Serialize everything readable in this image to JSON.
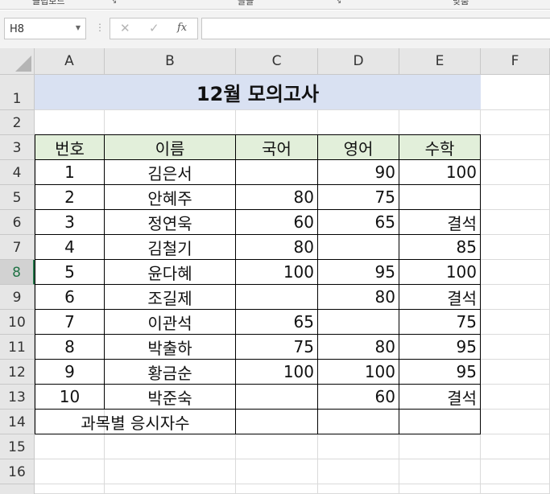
{
  "ribbon": {
    "group_clipboard": "클립보드",
    "group_font": "글꼴",
    "group_alignment": "맞춤",
    "launcher_glyph": "↘"
  },
  "formula_bar": {
    "name_box": "H8",
    "cancel_glyph": "✕",
    "enter_glyph": "✓",
    "fx_glyph": "fx",
    "formula": ""
  },
  "sheet": {
    "columns": [
      "A",
      "B",
      "C",
      "D",
      "E",
      "F"
    ],
    "rows": [
      "1",
      "2",
      "3",
      "4",
      "5",
      "6",
      "7",
      "8",
      "9",
      "10",
      "11",
      "12",
      "13",
      "14",
      "15",
      "16"
    ],
    "selected_row": "8",
    "title": "12월 모의고사",
    "headers": [
      "번호",
      "이름",
      "국어",
      "영어",
      "수학"
    ],
    "data": [
      [
        "1",
        "김은서",
        "",
        "90",
        "100"
      ],
      [
        "2",
        "안혜주",
        "80",
        "75",
        ""
      ],
      [
        "3",
        "정연욱",
        "60",
        "65",
        "결석"
      ],
      [
        "4",
        "김철기",
        "80",
        "",
        "85"
      ],
      [
        "5",
        "윤다혜",
        "100",
        "95",
        "100"
      ],
      [
        "6",
        "조길제",
        "",
        "80",
        "결석"
      ],
      [
        "7",
        "이관석",
        "65",
        "",
        "75"
      ],
      [
        "8",
        "박출하",
        "75",
        "80",
        "95"
      ],
      [
        "9",
        "황금순",
        "100",
        "100",
        "95"
      ],
      [
        "10",
        "박준숙",
        "",
        "60",
        "결석"
      ]
    ],
    "summary_label": "과목별 응시자수",
    "summary_values": [
      "",
      "",
      ""
    ]
  },
  "colors": {
    "title_fill": "#d9e1f2",
    "header_fill": "#e2efda",
    "selection": "#217346"
  }
}
